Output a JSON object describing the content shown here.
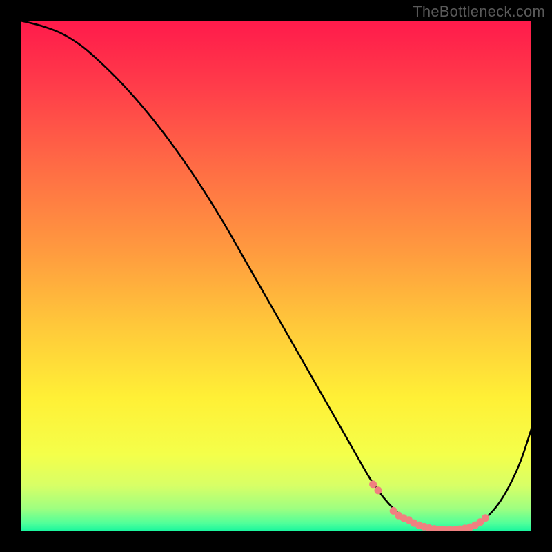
{
  "watermark": "TheBottleneck.com",
  "chart_data": {
    "type": "line",
    "title": "",
    "xlabel": "",
    "ylabel": "",
    "xlim": [
      0,
      100
    ],
    "ylim": [
      0,
      100
    ],
    "series": [
      {
        "name": "curve",
        "x": [
          0,
          4,
          8,
          12,
          16,
          20,
          24,
          28,
          32,
          36,
          40,
          44,
          48,
          52,
          56,
          60,
          64,
          68,
          70,
          72,
          74,
          76,
          78,
          80,
          82,
          84,
          86,
          88,
          90,
          92,
          94,
          96,
          98,
          100
        ],
        "y": [
          100,
          99,
          97.5,
          95,
          91.5,
          87.5,
          83,
          78,
          72.5,
          66.5,
          60,
          53,
          46,
          39,
          32,
          25,
          18,
          11,
          8,
          5.5,
          3.5,
          2.2,
          1.2,
          0.6,
          0.35,
          0.3,
          0.4,
          0.8,
          1.8,
          3.5,
          6,
          9.5,
          14,
          20
        ]
      }
    ],
    "highlight_points": {
      "name": "near-optimum-markers",
      "color": "#f08080",
      "x": [
        69,
        70,
        73,
        74,
        75,
        76,
        77,
        78,
        79,
        80,
        81,
        82,
        83,
        84,
        85,
        86,
        87,
        88,
        89,
        90,
        91
      ],
      "y": [
        9.2,
        8.0,
        4.0,
        3.1,
        2.6,
        2.2,
        1.6,
        1.2,
        0.9,
        0.6,
        0.45,
        0.35,
        0.32,
        0.3,
        0.32,
        0.4,
        0.55,
        0.8,
        1.2,
        1.8,
        2.6
      ]
    },
    "gradient_stops": [
      {
        "offset": 0.0,
        "color": "#ff1a4b"
      },
      {
        "offset": 0.12,
        "color": "#ff3a4a"
      },
      {
        "offset": 0.28,
        "color": "#ff6a45"
      },
      {
        "offset": 0.45,
        "color": "#ff9a3f"
      },
      {
        "offset": 0.6,
        "color": "#ffc93a"
      },
      {
        "offset": 0.74,
        "color": "#fff036"
      },
      {
        "offset": 0.85,
        "color": "#f4ff4a"
      },
      {
        "offset": 0.91,
        "color": "#d8ff66"
      },
      {
        "offset": 0.955,
        "color": "#9fff80"
      },
      {
        "offset": 0.985,
        "color": "#4fff9a"
      },
      {
        "offset": 1.0,
        "color": "#15f59e"
      }
    ]
  }
}
